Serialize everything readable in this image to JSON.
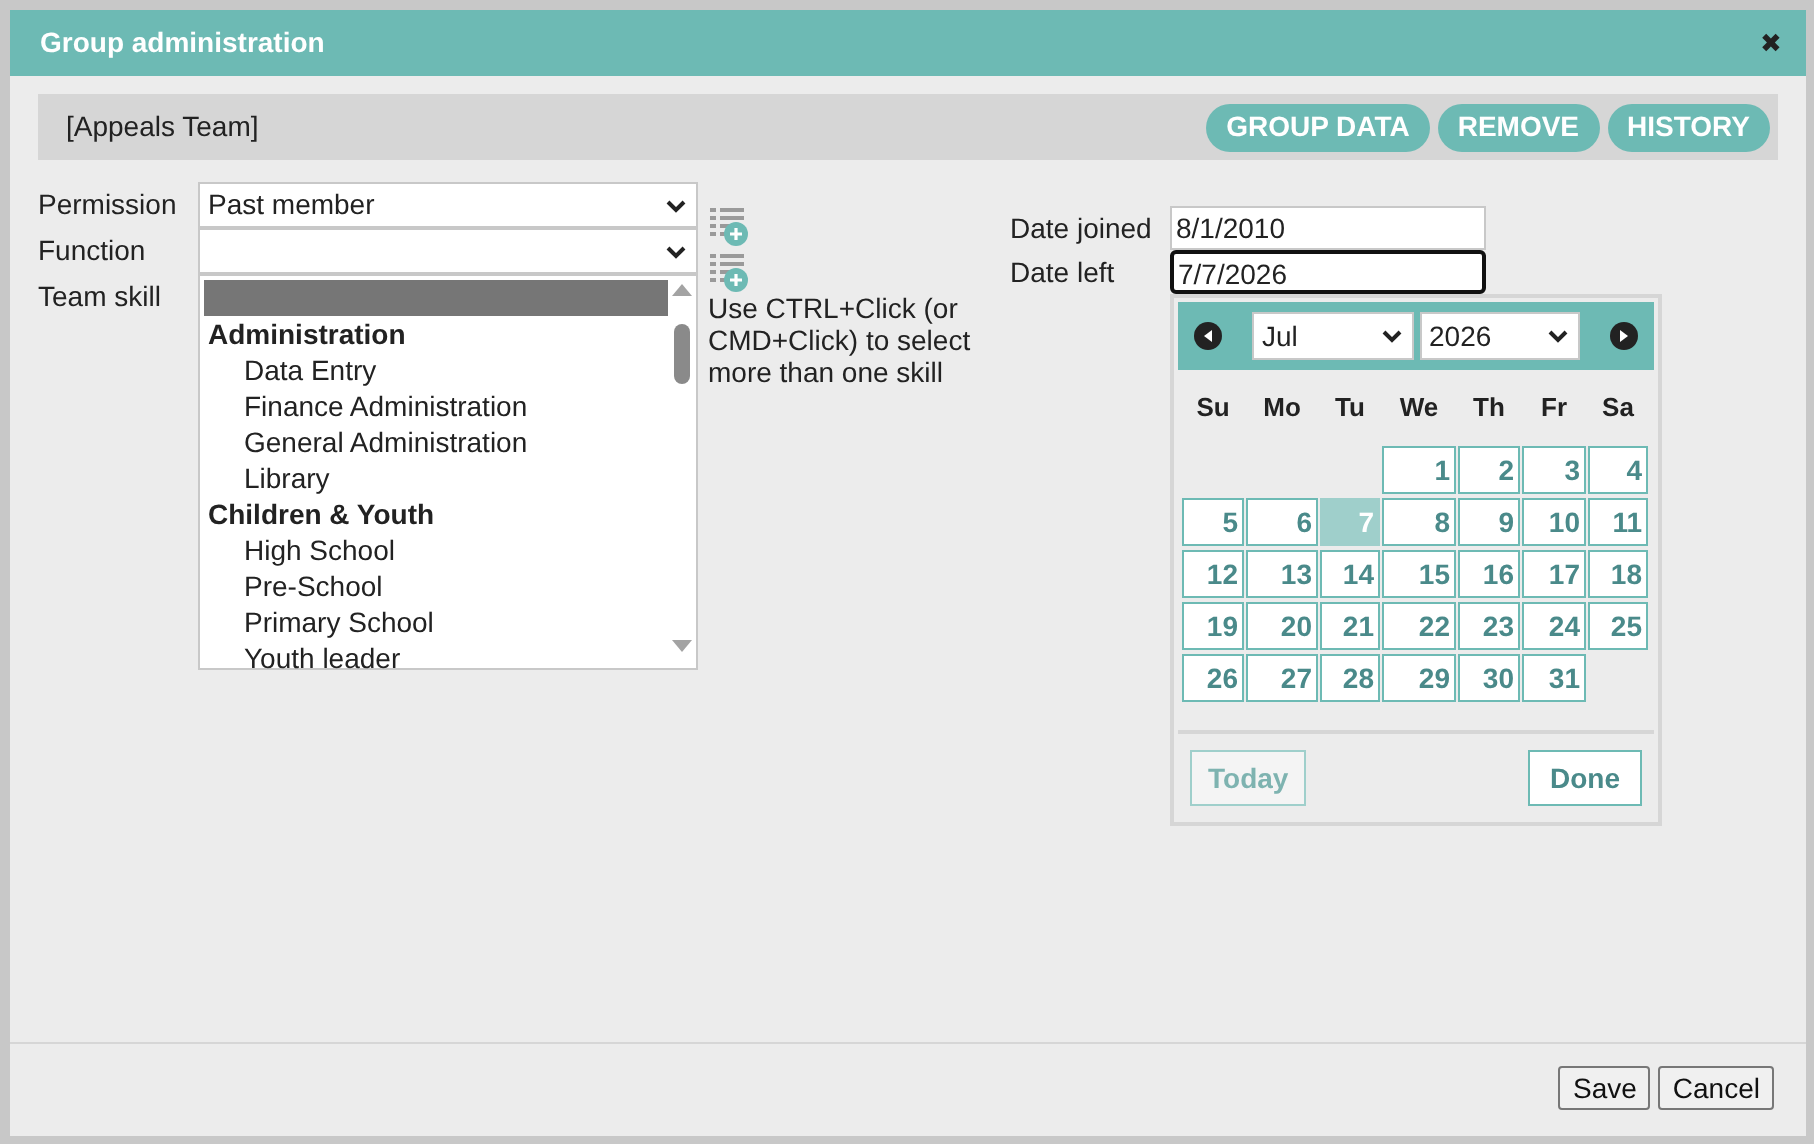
{
  "window": {
    "title": "Group administration",
    "close": "✖"
  },
  "group": {
    "name": "[Appeals Team]",
    "buttons": [
      "GROUP DATA",
      "REMOVE",
      "HISTORY"
    ]
  },
  "permission": {
    "label": "Permission",
    "value": "Past member"
  },
  "function": {
    "label": "Function"
  },
  "team_skill": {
    "label": "Team skill",
    "blank_option_selected": true,
    "groups": [
      {
        "label": "Administration",
        "children": [
          {
            "label": "Data Entry",
            "selected": false
          },
          {
            "label": "Finance Administration",
            "selected": false
          },
          {
            "label": "General Administration",
            "selected": false
          },
          {
            "label": "Library",
            "selected": false
          }
        ]
      },
      {
        "label": "Children & Youth",
        "children": [
          {
            "label": "High School",
            "selected": false
          },
          {
            "label": "Pre-School",
            "selected": false
          },
          {
            "label": "Primary School",
            "selected": false
          },
          {
            "label": "Youth leader",
            "selected": false
          }
        ]
      }
    ],
    "hint": "Use CTRL+Click (or CMD+Click) to select more than one skill"
  },
  "date_joined": {
    "label": "Date joined",
    "value": "8/1/2010"
  },
  "date_left": {
    "label": "Date left",
    "value": "7/7/2026",
    "focused": true
  },
  "datepicker": {
    "month": "Jul",
    "year": "2026",
    "weekdays": [
      "Su",
      "Mo",
      "Tu",
      "We",
      "Th",
      "Fr",
      "Sa"
    ],
    "weeks": [
      [
        {
          "day": "1",
          "selected": false
        },
        {
          "day": "2",
          "selected": false
        },
        {
          "day": "3",
          "selected": false
        },
        {
          "day": "4",
          "selected": false
        }
      ],
      [
        {
          "day": "5",
          "selected": false
        },
        {
          "day": "6",
          "selected": false
        },
        {
          "day": "7",
          "selected": true
        },
        {
          "day": "8",
          "selected": false
        },
        {
          "day": "9",
          "selected": false
        },
        {
          "day": "10",
          "selected": false
        },
        {
          "day": "11",
          "selected": false
        }
      ],
      [
        {
          "day": "12",
          "selected": false
        },
        {
          "day": "13",
          "selected": false
        },
        {
          "day": "14",
          "selected": false
        },
        {
          "day": "15",
          "selected": false
        },
        {
          "day": "16",
          "selected": false
        },
        {
          "day": "17",
          "selected": false
        },
        {
          "day": "18",
          "selected": false
        }
      ],
      [
        {
          "day": "19",
          "selected": false
        },
        {
          "day": "20",
          "selected": false
        },
        {
          "day": "21",
          "selected": false
        },
        {
          "day": "22",
          "selected": false
        },
        {
          "day": "23",
          "selected": false
        },
        {
          "day": "24",
          "selected": false
        },
        {
          "day": "25",
          "selected": false
        }
      ],
      [
        {
          "day": "26",
          "selected": false
        },
        {
          "day": "27",
          "selected": false
        },
        {
          "day": "28",
          "selected": false
        },
        {
          "day": "29",
          "selected": false
        },
        {
          "day": "30",
          "selected": false
        },
        {
          "day": "31",
          "selected": false
        }
      ]
    ],
    "today": "Today",
    "done": "Done"
  },
  "footer": {
    "buttons": [
      "Save",
      "Cancel"
    ]
  }
}
